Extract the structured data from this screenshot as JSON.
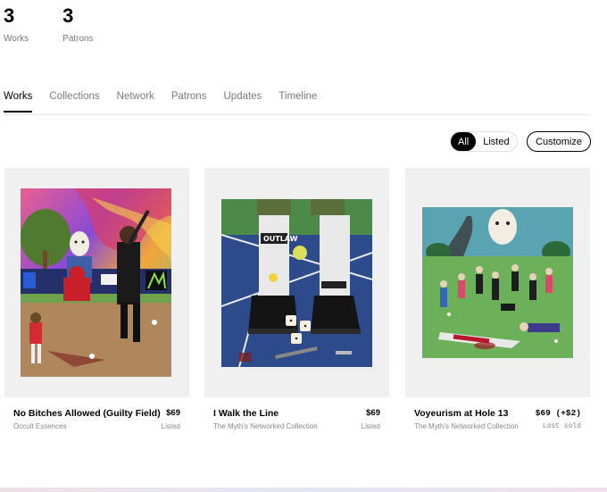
{
  "stats": [
    {
      "value": "3",
      "label": "Works"
    },
    {
      "value": "3",
      "label": "Patrons"
    }
  ],
  "tabs": [
    "Works",
    "Collections",
    "Network",
    "Patrons",
    "Updates",
    "Timeline"
  ],
  "active_tab": "Works",
  "filters": {
    "all": "All",
    "listed": "Listed",
    "active": "All"
  },
  "customize_label": "Customize",
  "works": [
    {
      "title": "No Bitches Allowed (Guilty Field)",
      "price": "$69",
      "collection": "Occult Essences",
      "status": "Listed",
      "art_icon": "baseball-hockey-mask-artwork"
    },
    {
      "title": "I Walk the Line",
      "price": "$69",
      "collection": "The Myth's Networked Collection",
      "status": "Listed",
      "art_icon": "sneakers-outlaw-artwork"
    },
    {
      "title": "Voyeurism at Hole 13",
      "price": "$69 (+$2)",
      "collection": "The Myth's Networked Collection",
      "status": "Last sold",
      "art_icon": "golf-course-chaos-artwork"
    }
  ]
}
